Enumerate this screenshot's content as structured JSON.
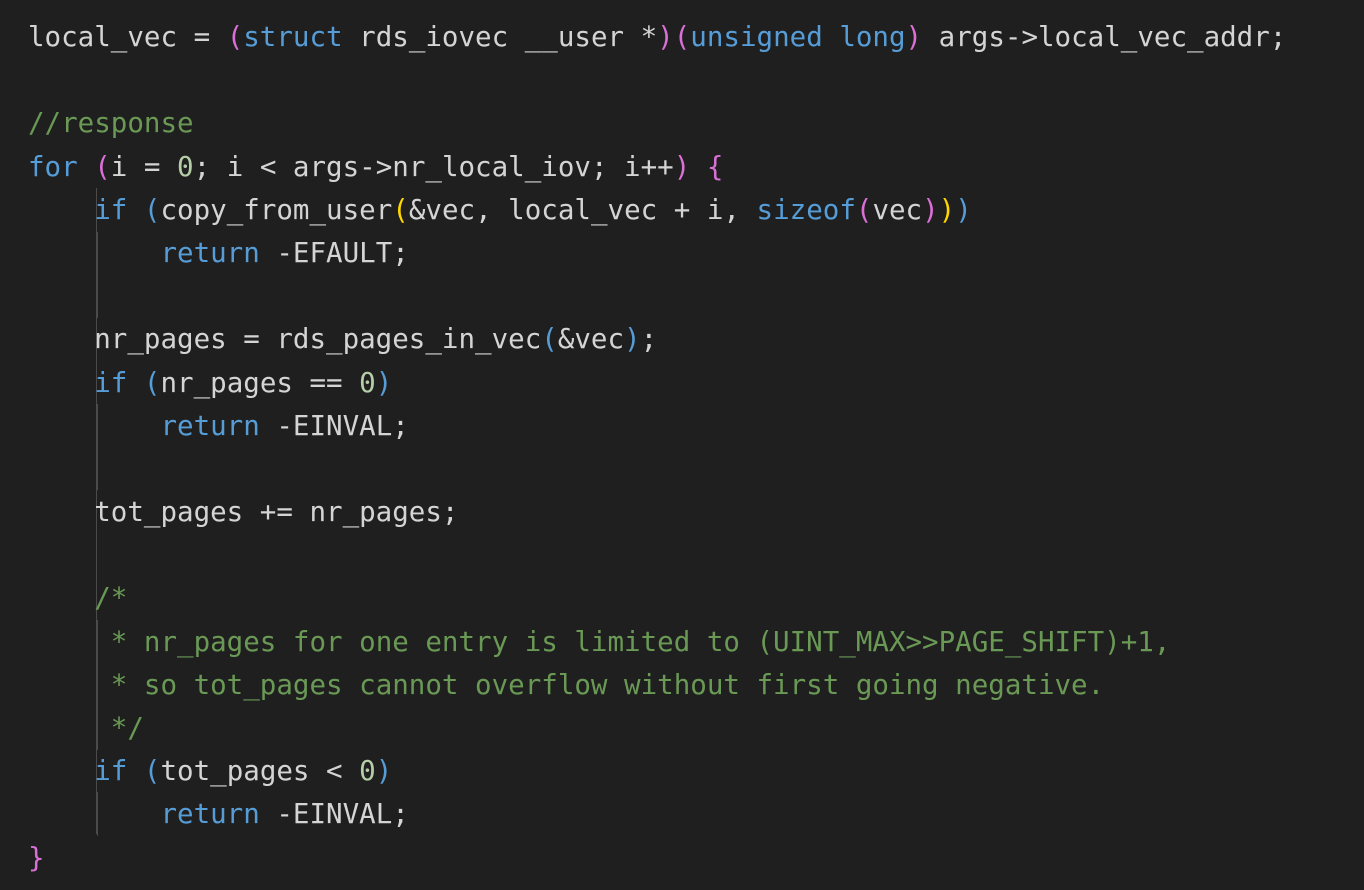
{
  "colors": {
    "background": "#1f1f1f",
    "default_text": "#d4d4d4",
    "keyword": "#569cd6",
    "control": "#c586c0",
    "comment": "#6a9955",
    "number": "#b5cea8",
    "bracket_level1": "#da70d6",
    "bracket_level2": "#569cd6",
    "bracket_level3": "#ffd700",
    "indent_guide": "#4b4b4b"
  },
  "code": {
    "lines": [
      [
        {
          "t": "local_vec = "
        },
        {
          "t": "(",
          "c": "p1"
        },
        {
          "t": "struct",
          "c": "kw"
        },
        {
          "t": " rds_iovec __user *"
        },
        {
          "t": ")",
          "c": "p1"
        },
        {
          "t": "(",
          "c": "p1"
        },
        {
          "t": "unsigned",
          "c": "kw"
        },
        {
          "t": " "
        },
        {
          "t": "long",
          "c": "kw"
        },
        {
          "t": ")",
          "c": "p1"
        },
        {
          "t": " args->local_vec_addr;"
        }
      ],
      [],
      [
        {
          "t": "//response",
          "c": "cm"
        }
      ],
      [
        {
          "t": "for",
          "c": "kw"
        },
        {
          "t": " "
        },
        {
          "t": "(",
          "c": "p1"
        },
        {
          "t": "i = "
        },
        {
          "t": "0",
          "c": "num"
        },
        {
          "t": "; i < args->nr_local_iov; i++"
        },
        {
          "t": ")",
          "c": "p1"
        },
        {
          "t": " "
        },
        {
          "t": "{",
          "c": "p1"
        }
      ],
      [
        {
          "t": "    "
        },
        {
          "t": "if",
          "c": "kw"
        },
        {
          "t": " "
        },
        {
          "t": "(",
          "c": "p2"
        },
        {
          "t": "copy_from_user"
        },
        {
          "t": "(",
          "c": "p3"
        },
        {
          "t": "&vec, local_vec + i, "
        },
        {
          "t": "sizeof",
          "c": "kw"
        },
        {
          "t": "(",
          "c": "p1"
        },
        {
          "t": "vec"
        },
        {
          "t": ")",
          "c": "p1"
        },
        {
          "t": ")",
          "c": "p3"
        },
        {
          "t": ")",
          "c": "p2"
        }
      ],
      [
        {
          "t": "        "
        },
        {
          "t": "return",
          "c": "kw"
        },
        {
          "t": " -EFAULT;"
        }
      ],
      [],
      [
        {
          "t": "    nr_pages = rds_pages_in_vec"
        },
        {
          "t": "(",
          "c": "p2"
        },
        {
          "t": "&vec"
        },
        {
          "t": ")",
          "c": "p2"
        },
        {
          "t": ";"
        }
      ],
      [
        {
          "t": "    "
        },
        {
          "t": "if",
          "c": "kw"
        },
        {
          "t": " "
        },
        {
          "t": "(",
          "c": "p2"
        },
        {
          "t": "nr_pages == "
        },
        {
          "t": "0",
          "c": "num"
        },
        {
          "t": ")",
          "c": "p2"
        }
      ],
      [
        {
          "t": "        "
        },
        {
          "t": "return",
          "c": "kw"
        },
        {
          "t": " -EINVAL;"
        }
      ],
      [],
      [
        {
          "t": "    tot_pages += nr_pages;"
        }
      ],
      [],
      [
        {
          "t": "    "
        },
        {
          "t": "/*",
          "c": "cm"
        }
      ],
      [
        {
          "t": "    "
        },
        {
          "t": " * nr_pages for one entry is limited to (UINT_MAX>>PAGE_SHIFT)+1,",
          "c": "cm"
        }
      ],
      [
        {
          "t": "    "
        },
        {
          "t": " * so tot_pages cannot overflow without first going negative.",
          "c": "cm"
        }
      ],
      [
        {
          "t": "    "
        },
        {
          "t": " */",
          "c": "cm"
        }
      ],
      [
        {
          "t": "    "
        },
        {
          "t": "if",
          "c": "kw"
        },
        {
          "t": " "
        },
        {
          "t": "(",
          "c": "p2"
        },
        {
          "t": "tot_pages < "
        },
        {
          "t": "0",
          "c": "num"
        },
        {
          "t": ")",
          "c": "p2"
        }
      ],
      [
        {
          "t": "        "
        },
        {
          "t": "return",
          "c": "kw"
        },
        {
          "t": " -EINVAL;"
        }
      ],
      [
        {
          "t": "}",
          "c": "p1"
        }
      ]
    ]
  }
}
